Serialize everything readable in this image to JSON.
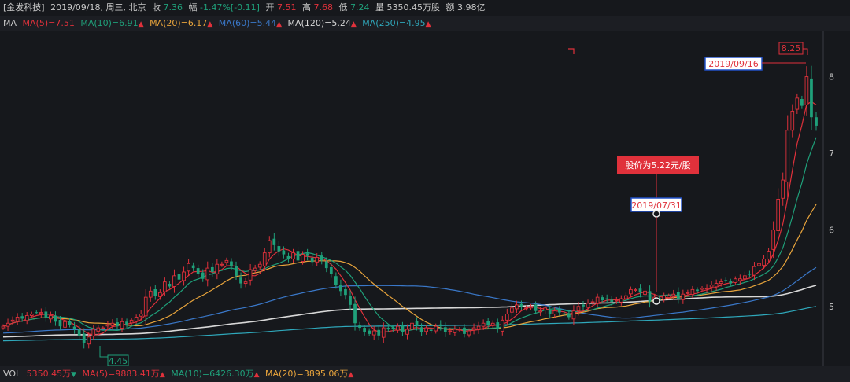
{
  "header": {
    "stock_name": "[金发科技]",
    "date_info": "2019/09/18, 周三, 北京",
    "close_label": "收",
    "close_value": "7.36",
    "change_label": "幅",
    "change_value": "-1.47%",
    "change_abs": "[-0.11]",
    "open_label": "开",
    "open_value": "7.51",
    "high_label": "高",
    "high_value": "7.68",
    "low_label": "低",
    "low_value": "7.24",
    "volume_label": "量",
    "volume_value": "5350.45万股",
    "amount_label": "额",
    "amount_value": "3.98亿"
  },
  "ma_legend": {
    "title": "MA",
    "items": [
      {
        "label": "MA(5)=7.51",
        "color": "#e0313b"
      },
      {
        "label": "MA(10)=6.91",
        "color": "#1fa07a"
      },
      {
        "label": "MA(20)=6.17",
        "color": "#e8a43c"
      },
      {
        "label": "MA(60)=5.44",
        "color": "#3a78c9"
      },
      {
        "label": "MA(120)=5.24",
        "color": "#d8d8d8"
      },
      {
        "label": "MA(250)=4.95",
        "color": "#2fa8bb"
      }
    ]
  },
  "vol_legend": {
    "title": "VOL",
    "items": [
      {
        "label": "5350.45万",
        "color": "#e0313b",
        "arrow": "down"
      },
      {
        "label": "MA(5)=9883.41万",
        "color": "#e0313b",
        "arrow": "up"
      },
      {
        "label": "MA(10)=6426.30万",
        "color": "#1fa07a",
        "arrow": "up"
      },
      {
        "label": "MA(20)=3895.06万",
        "color": "#e8a43c",
        "arrow": "up"
      }
    ]
  },
  "annotations": {
    "high_price": "8.25",
    "high_date": "2019/09/16",
    "mid_date": "2019/07/31",
    "mid_note": "股价为5.22元/股",
    "low_price": "4.45"
  },
  "chart_data": {
    "type": "candlestick",
    "yticks": [
      "8",
      "7",
      "6",
      "5"
    ],
    "ylim": [
      4.3,
      8.55
    ],
    "ma_colors": {
      "ma5": "#e0313b",
      "ma10": "#1fa07a",
      "ma20": "#e8a43c",
      "ma60": "#3a78c9",
      "ma120": "#d8d8d8",
      "ma250": "#2fa8bb"
    },
    "up_color": "#e0313b",
    "down_color": "#1fa07a",
    "close": [
      4.74,
      4.78,
      4.82,
      4.86,
      4.84,
      4.88,
      4.9,
      4.92,
      4.92,
      4.86,
      4.88,
      4.8,
      4.74,
      4.8,
      4.76,
      4.7,
      4.62,
      4.52,
      4.6,
      4.7,
      4.72,
      4.72,
      4.76,
      4.78,
      4.74,
      4.8,
      4.76,
      4.82,
      4.86,
      4.9,
      5.12,
      5.2,
      5.14,
      5.18,
      5.32,
      5.26,
      5.4,
      5.35,
      5.45,
      5.56,
      5.5,
      5.42,
      5.36,
      5.5,
      5.45,
      5.55,
      5.55,
      5.6,
      5.52,
      5.4,
      5.3,
      5.32,
      5.48,
      5.5,
      5.55,
      5.7,
      5.86,
      5.8,
      5.72,
      5.68,
      5.62,
      5.7,
      5.6,
      5.68,
      5.66,
      5.58,
      5.64,
      5.6,
      5.5,
      5.42,
      5.28,
      5.2,
      5.15,
      5.02,
      4.78,
      4.72,
      4.66,
      4.64,
      4.68,
      4.62,
      4.72,
      4.7,
      4.7,
      4.74,
      4.66,
      4.7,
      4.78,
      4.74,
      4.66,
      4.72,
      4.68,
      4.74,
      4.74,
      4.66,
      4.68,
      4.7,
      4.7,
      4.64,
      4.68,
      4.72,
      4.74,
      4.78,
      4.76,
      4.78,
      4.7,
      4.82,
      4.9,
      4.98,
      5.02,
      5.0,
      4.98,
      5.0,
      4.94,
      4.94,
      4.98,
      4.9,
      4.94,
      4.92,
      4.9,
      4.86,
      4.94,
      5.0,
      5.0,
      5.04,
      5.06,
      5.12,
      5.08,
      5.1,
      5.06,
      5.08,
      5.1,
      5.14,
      5.22,
      5.22,
      5.18,
      5.2,
      5.06,
      5.12,
      5.08,
      5.14,
      5.14,
      5.16,
      5.1,
      5.16,
      5.18,
      5.22,
      5.2,
      5.24,
      5.24,
      5.28,
      5.3,
      5.32,
      5.34,
      5.3,
      5.36,
      5.36,
      5.4,
      5.42,
      5.52,
      5.56,
      5.62,
      5.72,
      6.0,
      6.4,
      6.65,
      7.3,
      7.55,
      7.72,
      7.62,
      8.0,
      7.47,
      7.36
    ],
    "labels": [
      "2019/09/16",
      "2019/07/31"
    ]
  }
}
